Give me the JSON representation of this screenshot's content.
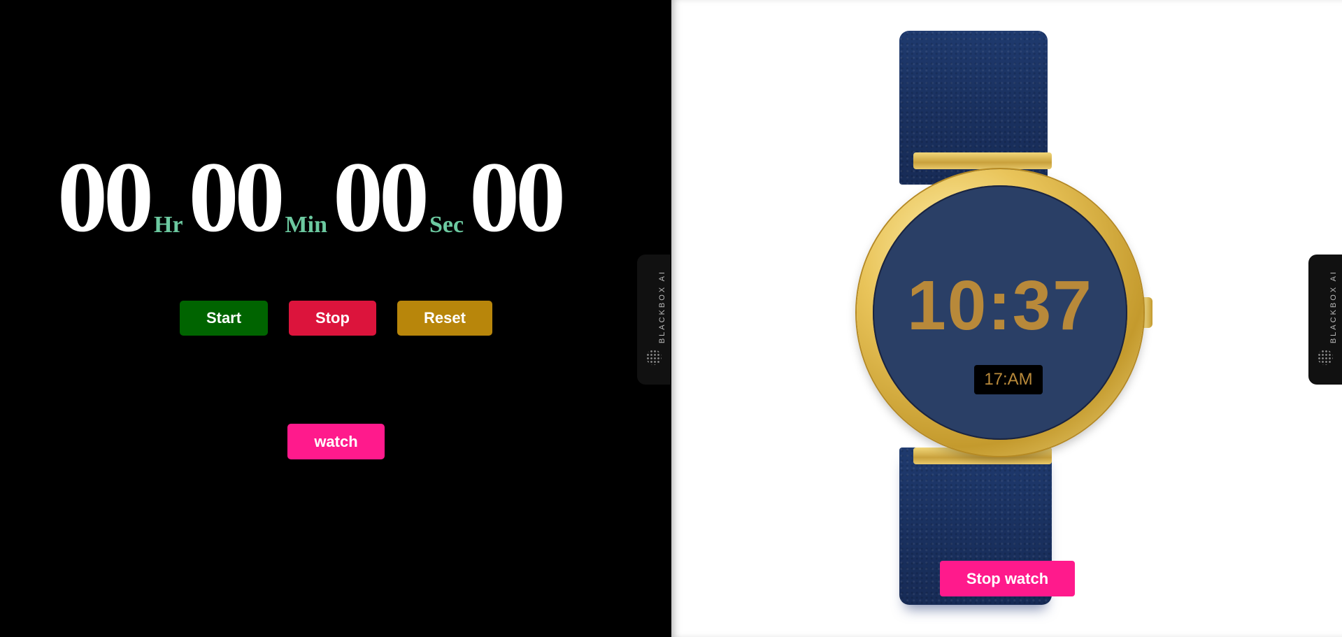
{
  "stopwatch": {
    "hours": "00",
    "hours_unit": "Hr",
    "minutes": "00",
    "minutes_unit": "Min",
    "seconds": "00",
    "seconds_unit": "Sec",
    "centiseconds": "00"
  },
  "controls": {
    "start_label": "Start",
    "stop_label": "Stop",
    "reset_label": "Reset",
    "watch_label": "watch"
  },
  "side_tab": {
    "label": "BLACKBOX AI",
    "icon": "dots-logo-icon"
  },
  "watch": {
    "time": "10:37",
    "period": "17:AM",
    "stop_watch_label": "Stop watch"
  },
  "colors": {
    "start": "#006400",
    "stop": "#dc143c",
    "reset": "#b8860b",
    "pink": "#ff1a8c",
    "unit_text": "#6cc9a0",
    "watch_face": "#2a3f66",
    "watch_digits": "#b8893a"
  }
}
